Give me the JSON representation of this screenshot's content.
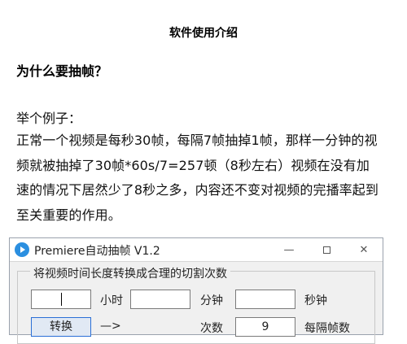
{
  "document": {
    "title": "软件使用介绍",
    "heading": "为什么要抽帧？",
    "example_label": "举个例子：",
    "paragraph": "正常一个视频是每秒30帧，每隔7帧抽掉1帧，那样一分钟的视频就被抽掉了30帧*60s/7=257顿（8秒左右）视频在没有加速的情况下居然少了8秒之多，内容还不变对视频的完播率起到至关重要的作用。"
  },
  "window": {
    "title": "Premiere自动抽帧 V1.2",
    "controls": {
      "minimize": "—",
      "maximize": "□",
      "close": "✕"
    },
    "icon": "premiere-play-icon",
    "group_label": "将视频时间长度转换成合理的切割次数",
    "row1": {
      "hours_value": "",
      "hours_unit": "小时",
      "minutes_value": "",
      "minutes_unit": "分钟",
      "seconds_value": "",
      "seconds_unit": "秒钟"
    },
    "row2": {
      "convert_button": "转换",
      "arrow": "—>",
      "count_label": "次数",
      "count_value": "9",
      "per_frames_label": "每隔帧数"
    }
  },
  "colors": {
    "accent": "#2b8fe0",
    "button_border": "#2a6fd6",
    "window_bg": "#f0f0f0"
  }
}
